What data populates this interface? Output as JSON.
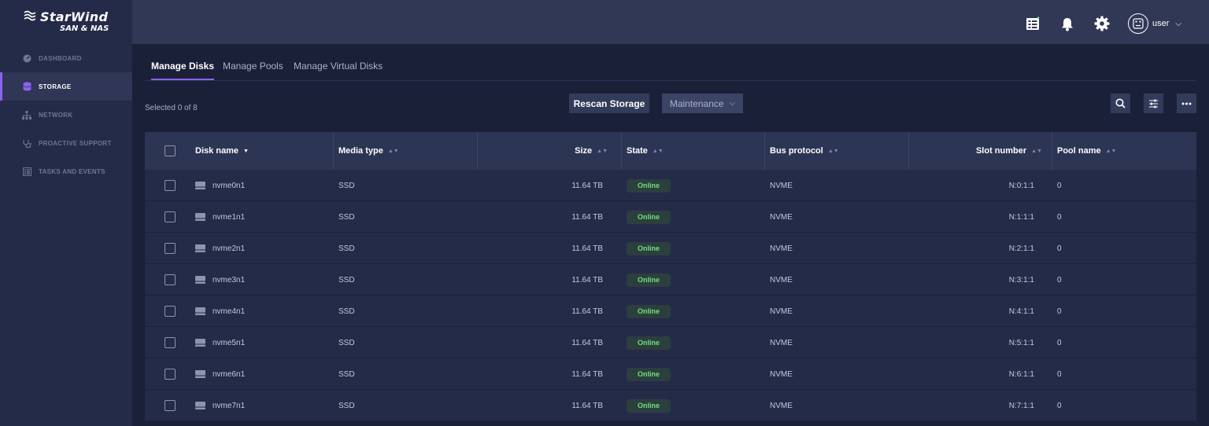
{
  "brand": {
    "name": "StarWind",
    "sub": "SAN & NAS"
  },
  "sidebar": {
    "items": [
      {
        "label": "DASHBOARD",
        "icon": "dashboard-icon",
        "active": false
      },
      {
        "label": "STORAGE",
        "icon": "storage-icon",
        "active": true
      },
      {
        "label": "NETWORK",
        "icon": "network-icon",
        "active": false
      },
      {
        "label": "PROACTIVE SUPPORT",
        "icon": "stethoscope-icon",
        "active": false
      },
      {
        "label": "TASKS AND EVENTS",
        "icon": "tasks-icon",
        "active": false
      }
    ]
  },
  "topbar": {
    "icons": [
      "tasks-list-icon",
      "bell-icon",
      "gear-icon"
    ],
    "user": {
      "name": "user",
      "icon": "user-avatar-icon"
    }
  },
  "tabs": [
    {
      "label": "Manage Disks",
      "active": true
    },
    {
      "label": "Manage Pools",
      "active": false
    },
    {
      "label": "Manage Virtual Disks",
      "active": false
    }
  ],
  "toolbar": {
    "selected": "Selected 0 of 8",
    "rescan_label": "Rescan Storage",
    "maintenance_label": "Maintenance",
    "tools": [
      "search-icon",
      "filter-sliders-icon",
      "more-icon"
    ]
  },
  "table": {
    "columns": [
      "Disk name",
      "Media type",
      "Size",
      "State",
      "Bus protocol",
      "Slot number",
      "Pool name"
    ],
    "rows": [
      {
        "name": "nvme0n1",
        "media": "SSD",
        "size": "11.64 TB",
        "state": "Online",
        "bus": "NVME",
        "slot": "N:0:1:1",
        "pool": "0"
      },
      {
        "name": "nvme1n1",
        "media": "SSD",
        "size": "11.64 TB",
        "state": "Online",
        "bus": "NVME",
        "slot": "N:1:1:1",
        "pool": "0"
      },
      {
        "name": "nvme2n1",
        "media": "SSD",
        "size": "11.64 TB",
        "state": "Online",
        "bus": "NVME",
        "slot": "N:2:1:1",
        "pool": "0"
      },
      {
        "name": "nvme3n1",
        "media": "SSD",
        "size": "11.64 TB",
        "state": "Online",
        "bus": "NVME",
        "slot": "N:3:1:1",
        "pool": "0"
      },
      {
        "name": "nvme4n1",
        "media": "SSD",
        "size": "11.64 TB",
        "state": "Online",
        "bus": "NVME",
        "slot": "N:4:1:1",
        "pool": "0"
      },
      {
        "name": "nvme5n1",
        "media": "SSD",
        "size": "11.64 TB",
        "state": "Online",
        "bus": "NVME",
        "slot": "N:5:1:1",
        "pool": "0"
      },
      {
        "name": "nvme6n1",
        "media": "SSD",
        "size": "11.64 TB",
        "state": "Online",
        "bus": "NVME",
        "slot": "N:6:1:1",
        "pool": "0"
      },
      {
        "name": "nvme7n1",
        "media": "SSD",
        "size": "11.64 TB",
        "state": "Online",
        "bus": "NVME",
        "slot": "N:7:1:1",
        "pool": "0"
      }
    ]
  },
  "colors": {
    "accent": "#8a63f0",
    "online": "#6ee07e",
    "sidebar_bg": "#242b48",
    "page_bg": "#1a2038"
  }
}
